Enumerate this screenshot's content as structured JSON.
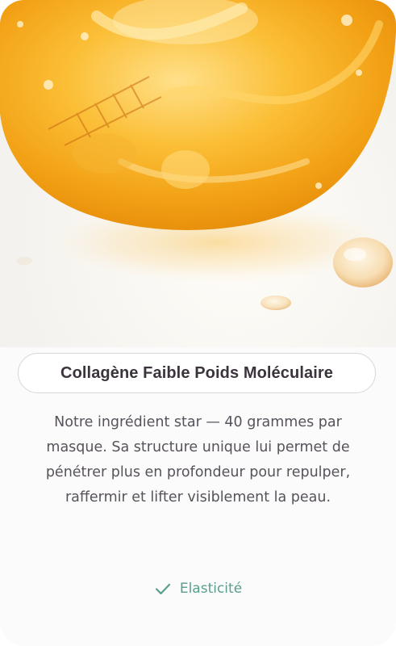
{
  "card": {
    "image": {
      "subject": "golden-collagen-gel-sphere",
      "icon": "collagen-gel-image"
    },
    "title": "Collagène Faible Poids Moléculaire",
    "description": "Notre ingrédient star — 40 grammes par masque. Sa structure unique lui permet de pénétrer plus en profondeur pour repulper, raffermir et lifter visiblement la peau.",
    "benefit": {
      "icon": "check-icon",
      "label": "Elasticité"
    }
  },
  "colors": {
    "title_text": "#3b343c",
    "body_text": "#58525b",
    "accent_green": "#5a9e8d",
    "pill_border": "#d9d6db",
    "gel_gold": "#f4a51c"
  }
}
